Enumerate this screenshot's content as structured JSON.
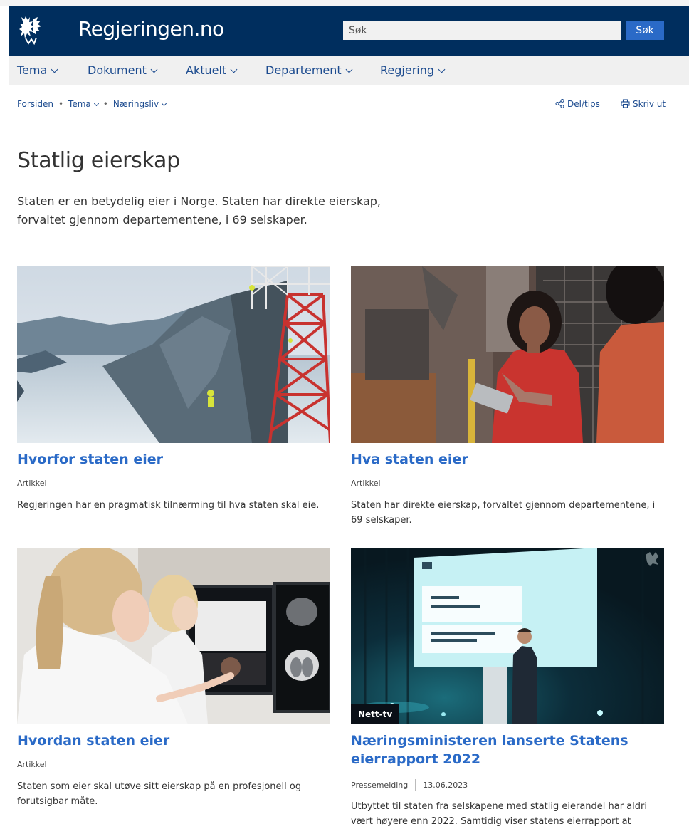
{
  "header": {
    "site_name": "Regjeringen.no",
    "search_placeholder": "Søk",
    "search_button": "Søk",
    "brand_color": "#002e5e",
    "accent_color": "#2a6ac7"
  },
  "nav": {
    "items": [
      {
        "label": "Tema"
      },
      {
        "label": "Dokument"
      },
      {
        "label": "Aktuelt"
      },
      {
        "label": "Departement"
      },
      {
        "label": "Regjering"
      }
    ]
  },
  "breadcrumb": {
    "home": "Forsiden",
    "level1": "Tema",
    "level2": "Næringsliv"
  },
  "tools": {
    "share": "Del/tips",
    "print": "Skriv ut",
    "share_icon": "share-icon",
    "print_icon": "printer-icon"
  },
  "main": {
    "title": "Statlig eierskap",
    "lead": "Staten er en betydelig eier i Norge. Staten har direkte eierskap, forvaltet gjennom departementene, i 69 selskaper."
  },
  "cards": [
    {
      "title": "Hvorfor staten eier",
      "type": "Artikkel",
      "description": "Regjeringen har en pragmatisk tilnærming til hva staten skal eie."
    },
    {
      "title": "Hva staten eier",
      "type": "Artikkel",
      "description": "Staten har direkte eierskap, forvaltet gjennom departementene, i 69 selskaper."
    },
    {
      "title": "Hvordan staten eier",
      "type": "Artikkel",
      "description": "Staten som eier skal utøve sitt eierskap på en profesjonell og forutsigbar måte."
    },
    {
      "title": "Næringsministeren lanserte Statens eierrapport 2022",
      "type": "Pressemelding",
      "date": "13.06.2023",
      "badge": "Nett-tv",
      "description": "Utbyttet til staten fra selskapene med statlig eierandel har aldri vært høyere enn 2022. Samtidig viser statens eierrapport at"
    }
  ]
}
